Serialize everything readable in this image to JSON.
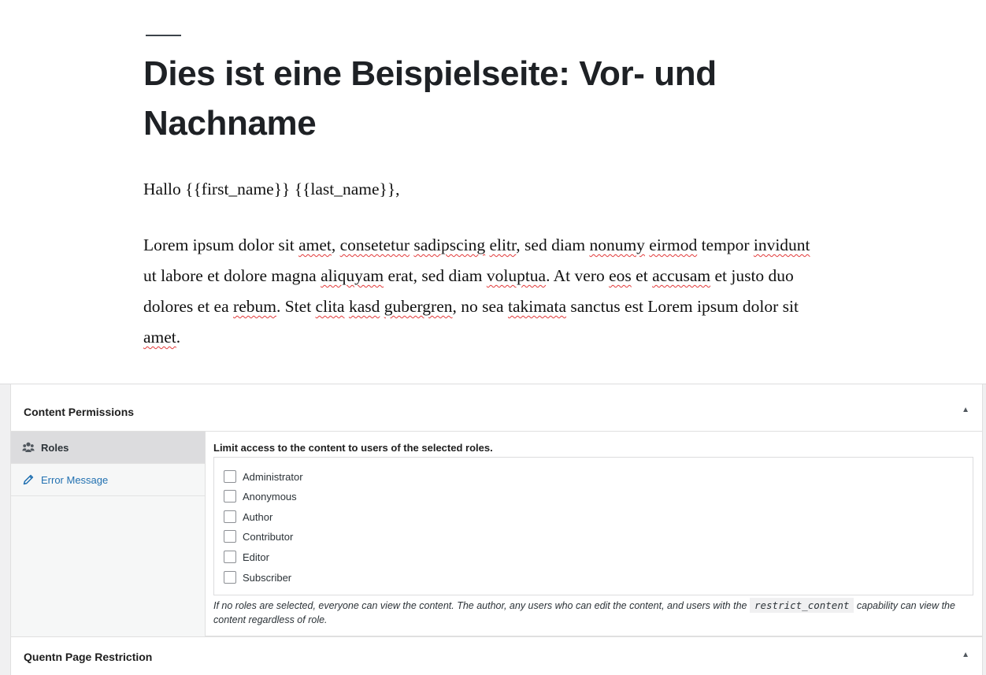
{
  "editor": {
    "title": "Dies ist eine Beispielseite: Vor- und Nachname",
    "greeting": "Hallo {{first_name}} {{last_name}},",
    "lorem_segments": [
      {
        "t": "Lorem ipsum dolor sit ",
        "s": false
      },
      {
        "t": "amet",
        "s": true
      },
      {
        "t": ", ",
        "s": false
      },
      {
        "t": "consetetur",
        "s": true
      },
      {
        "t": " ",
        "s": false
      },
      {
        "t": "sadipscing",
        "s": true
      },
      {
        "t": " ",
        "s": false
      },
      {
        "t": "elitr",
        "s": true
      },
      {
        "t": ", sed diam ",
        "s": false
      },
      {
        "t": "nonumy",
        "s": true
      },
      {
        "t": " ",
        "s": false
      },
      {
        "t": "eirmod",
        "s": true
      },
      {
        "t": " tempor ",
        "s": false
      },
      {
        "t": "invidunt",
        "s": true
      },
      {
        "t": " ut labore et dolore magna ",
        "s": false
      },
      {
        "t": "aliquyam",
        "s": true
      },
      {
        "t": " erat, sed diam ",
        "s": false
      },
      {
        "t": "voluptua",
        "s": true
      },
      {
        "t": ". At vero ",
        "s": false
      },
      {
        "t": "eos",
        "s": true
      },
      {
        "t": " et ",
        "s": false
      },
      {
        "t": "accusam",
        "s": true
      },
      {
        "t": " et justo duo dolores et ea ",
        "s": false
      },
      {
        "t": "rebum",
        "s": true
      },
      {
        "t": ". Stet ",
        "s": false
      },
      {
        "t": "clita",
        "s": true
      },
      {
        "t": " ",
        "s": false
      },
      {
        "t": "kasd",
        "s": true
      },
      {
        "t": " ",
        "s": false
      },
      {
        "t": "gubergren",
        "s": true
      },
      {
        "t": ", no sea ",
        "s": false
      },
      {
        "t": "takimata",
        "s": true
      },
      {
        "t": " sanctus est Lorem ipsum dolor sit ",
        "s": false
      },
      {
        "t": "amet",
        "s": true
      },
      {
        "t": ".",
        "s": false
      }
    ]
  },
  "content_permissions": {
    "title": "Content Permissions",
    "toggle_icon": "▲",
    "tabs": [
      {
        "label": "Roles",
        "icon": "groups-icon",
        "active": true
      },
      {
        "label": "Error Message",
        "icon": "pencil-icon",
        "active": false
      }
    ],
    "roles_label": "Limit access to the content to users of the selected roles.",
    "roles": [
      {
        "label": "Administrator",
        "checked": false
      },
      {
        "label": "Anonymous",
        "checked": false
      },
      {
        "label": "Author",
        "checked": false
      },
      {
        "label": "Contributor",
        "checked": false
      },
      {
        "label": "Editor",
        "checked": false
      },
      {
        "label": "Subscriber",
        "checked": false
      }
    ],
    "note_before": "If no roles are selected, everyone can view the content. The author, any users who can edit the content, and users with the",
    "note_code": "restrict_content",
    "note_after": "capability can view the content regardless of role."
  },
  "quentn": {
    "title": "Quentn Page Restriction",
    "toggle_icon": "▲"
  },
  "colors": {
    "link": "#2271b1",
    "spellcheck": "#e23a3a",
    "active_tab": "#dcdcde"
  }
}
